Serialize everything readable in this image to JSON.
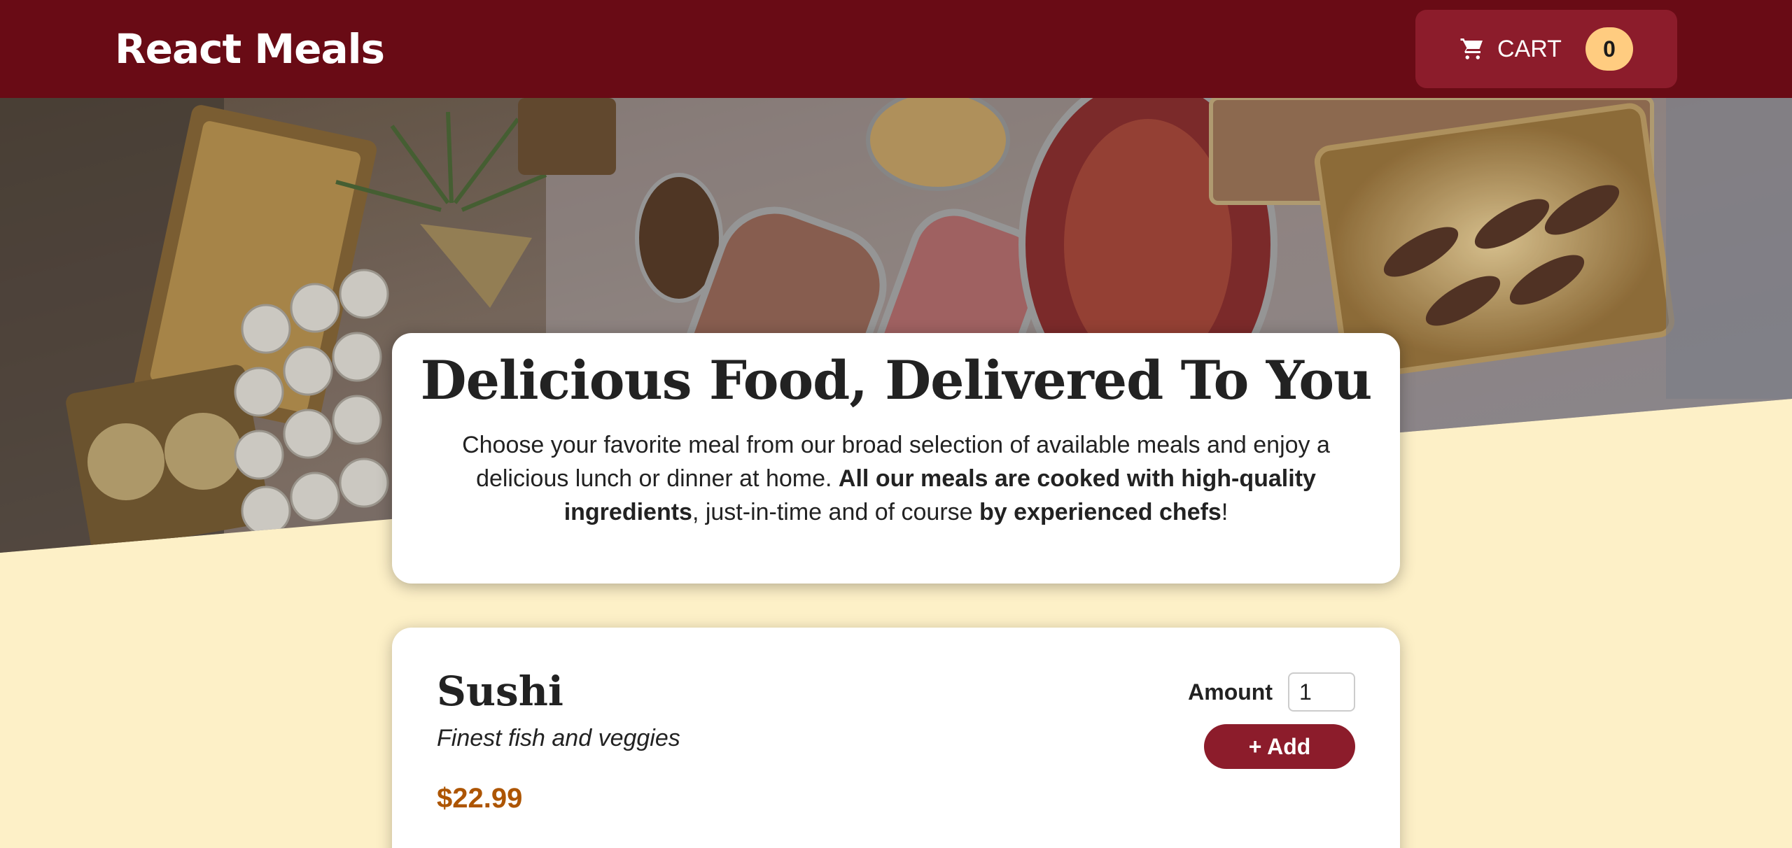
{
  "header": {
    "title": "React Meals",
    "cart": {
      "label": "CART",
      "count": "0"
    }
  },
  "summary": {
    "heading": "Delicious Food, Delivered To You",
    "text_part1": "Choose your favorite meal from our broad selection of available meals and enjoy a delicious lunch or dinner at home. ",
    "text_bold1": "All our meals are cooked with high-quality ingredients",
    "text_part2": ", just-in-time and of course ",
    "text_bold2": "by experienced chefs",
    "text_part3": "!"
  },
  "meals": [
    {
      "name": "Sushi",
      "description": "Finest fish and veggies",
      "price": "$22.99",
      "amount_label": "Amount",
      "amount_value": "1",
      "add_label": "+ Add"
    }
  ],
  "colors": {
    "header_bg": "#690b15",
    "cart_button_bg": "#8c1c2b",
    "badge_bg": "#ffcc80",
    "page_bg": "#fdf0c7",
    "price": "#ad5502"
  },
  "icons": {
    "cart": "shopping-cart-icon"
  }
}
